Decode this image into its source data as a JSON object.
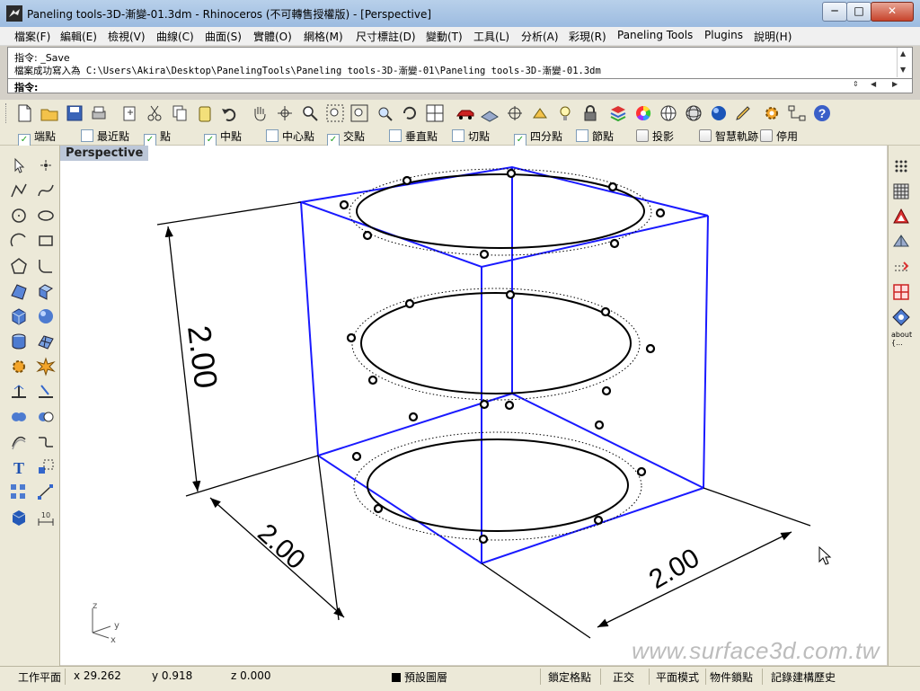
{
  "window": {
    "title": "Paneling tools-3D-漸變-01.3dm - Rhinoceros (不可轉售授權版) - [Perspective]",
    "min_glyph": "─",
    "max_glyph": "□",
    "close_glyph": "✕"
  },
  "menu": [
    "檔案(F)",
    "編輯(E)",
    "檢視(V)",
    "曲線(C)",
    "曲面(S)",
    "實體(O)",
    "網格(M)",
    "尺寸標註(D)",
    "變動(T)",
    "工具(L)",
    "分析(A)",
    "彩現(R)",
    "Paneling Tools",
    "Plugins",
    "說明(H)"
  ],
  "command": {
    "history_1": "指令: _Save",
    "history_2": "檔案成功寫入為 C:\\Users\\Akira\\Desktop\\PanelingTools\\Paneling tools-3D-漸變-01\\Paneling tools-3D-漸變-01.3dm",
    "prompt": "指令:",
    "input_value": ""
  },
  "toolbar_icons": [
    "new-file-icon",
    "open-file-icon",
    "save-icon",
    "print-icon",
    "import-icon",
    "cut-icon",
    "copy-icon",
    "paste-icon",
    "undo-icon",
    "pan-hand-icon",
    "rotate-view-icon",
    "zoom-dynamic-icon",
    "zoom-window-icon",
    "zoom-extents-icon",
    "zoom-selected-icon",
    "undo-view-icon",
    "four-viewports-icon",
    "car-icon",
    "grid-plane-icon",
    "cplane-icon",
    "move-cplane-icon",
    "light-bulb-icon",
    "lock-icon",
    "layer-icon",
    "color-wheel-icon",
    "sphere-wire-icon",
    "sphere-grid-icon",
    "render-sphere-icon",
    "pencil-icon",
    "gear-icon",
    "osnap-tree-icon",
    "help-icon"
  ],
  "osnaps": [
    {
      "label": "端點",
      "checked": true,
      "kind": "check"
    },
    {
      "label": "最近點",
      "checked": false,
      "kind": "check"
    },
    {
      "label": "點",
      "checked": true,
      "kind": "check"
    },
    {
      "label": "中點",
      "checked": true,
      "kind": "check"
    },
    {
      "label": "中心點",
      "checked": false,
      "kind": "check"
    },
    {
      "label": "交點",
      "checked": true,
      "kind": "check"
    },
    {
      "label": "垂直點",
      "checked": false,
      "kind": "check"
    },
    {
      "label": "切點",
      "checked": false,
      "kind": "check"
    },
    {
      "label": "四分點",
      "checked": true,
      "kind": "check"
    },
    {
      "label": "節點",
      "checked": false,
      "kind": "check"
    },
    {
      "label": "投影",
      "checked": false,
      "kind": "toggle"
    },
    {
      "label": "智慧軌跡",
      "checked": false,
      "kind": "toggle"
    },
    {
      "label": "停用",
      "checked": false,
      "kind": "toggle"
    }
  ],
  "left_tools": [
    "select-arrow-icon",
    "point-icon",
    "polyline-icon",
    "curve-icon",
    "circle-icon",
    "ellipse-icon",
    "arc-icon",
    "rectangle-icon",
    "polygon-icon",
    "fillet-icon",
    "surface-corner-icon",
    "extrude-surface-icon",
    "box-solid-icon",
    "sphere-solid-icon",
    "cylinder-solid-icon",
    "mesh-plane-icon",
    "transform-gear-icon",
    "explode-icon",
    "split-icon",
    "trim-icon",
    "boolean-union-icon",
    "boolean-diff-icon",
    "offset-curve-icon",
    "blend-curve-icon",
    "text-icon",
    "scale-icon",
    "array-icon",
    "edit-points-icon",
    "cube-render-icon",
    "dimension-icon"
  ],
  "right_tools": [
    "point-grid-icon",
    "dense-grid-icon",
    "triangle-panel-icon",
    "pyramid-panel-icon",
    "offset-grid-icon",
    "cell-grid-icon",
    "diamond-panel-icon"
  ],
  "about_label": "about\n{...",
  "viewport": {
    "name": "Perspective",
    "dimension_height": "2.00",
    "dimension_depth": "2.00",
    "dimension_width": "2.00",
    "axis_z": "z",
    "axis_y": "y",
    "axis_x": "x",
    "watermark": "www.surface3d.com.tw",
    "box_color": "#1a1aff"
  },
  "status": {
    "cplane": "工作平面",
    "x": "x 29.262",
    "y": "y 0.918",
    "z": "z 0.000",
    "layer": "預設圖層",
    "grid_snap": "鎖定格點",
    "ortho": "正交",
    "planar": "平面模式",
    "osnap": "物件鎖點",
    "history": "記錄建構歷史"
  }
}
